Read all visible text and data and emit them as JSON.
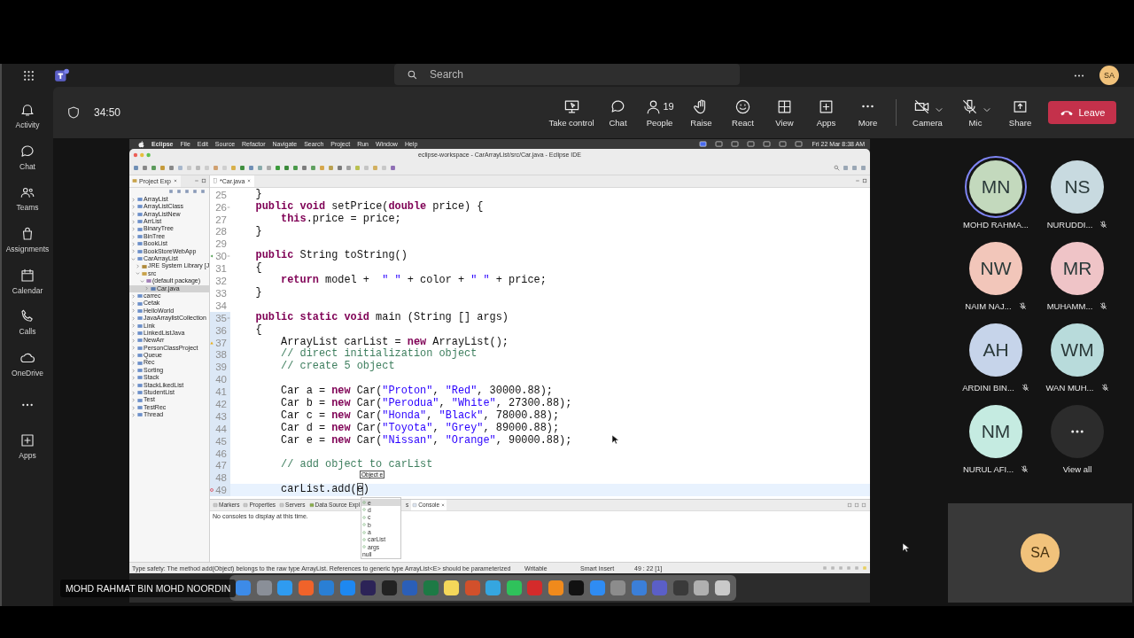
{
  "topbar": {
    "search": {
      "placeholder": "Search"
    },
    "user_initials": "SA"
  },
  "rail": [
    {
      "label": "Activity",
      "kind": "activity"
    },
    {
      "label": "Chat",
      "kind": "chat"
    },
    {
      "label": "Teams",
      "kind": "teams"
    },
    {
      "label": "Assignments",
      "kind": "assignments"
    },
    {
      "label": "Calendar",
      "kind": "calendar"
    },
    {
      "label": "Calls",
      "kind": "calls"
    },
    {
      "label": "OneDrive",
      "kind": "onedrive"
    },
    {
      "kind": "more"
    },
    {
      "label": "Apps",
      "kind": "apps"
    }
  ],
  "meeting": {
    "timer": "34:50",
    "controls": [
      {
        "label": "Take control",
        "kind": "take-control"
      },
      {
        "label": "Chat",
        "kind": "chat"
      },
      {
        "label": "People",
        "kind": "people",
        "count": "19"
      },
      {
        "label": "Raise",
        "kind": "raise"
      },
      {
        "label": "React",
        "kind": "react"
      },
      {
        "label": "View",
        "kind": "view"
      },
      {
        "label": "Apps",
        "kind": "apps"
      },
      {
        "label": "More",
        "kind": "more"
      }
    ],
    "devices": [
      {
        "label": "Camera",
        "kind": "camera",
        "off": true
      },
      {
        "label": "Mic",
        "kind": "mic",
        "off": true
      }
    ],
    "share": {
      "label": "Share"
    },
    "leave": {
      "label": "Leave"
    }
  },
  "participants": [
    {
      "initials": "MN",
      "name": "MOHD RAHMA...",
      "muted": false,
      "speaking": true,
      "color": "#c3d9bd"
    },
    {
      "initials": "NS",
      "name": "NURUDDI...",
      "muted": true,
      "speaking": false,
      "color": "#c8dae0"
    },
    {
      "initials": "NW",
      "name": "NAIM NAJ...",
      "muted": true,
      "speaking": false,
      "color": "#f2c6ba"
    },
    {
      "initials": "MR",
      "name": "MUHAMM...",
      "muted": true,
      "speaking": false,
      "color": "#efc4c7"
    },
    {
      "initials": "AH",
      "name": "ARDINI BIN...",
      "muted": true,
      "speaking": false,
      "color": "#c6d4ea"
    },
    {
      "initials": "WM",
      "name": "WAN MUH...",
      "muted": true,
      "speaking": false,
      "color": "#b8dbdb"
    },
    {
      "initials": "NM",
      "name": "NURUL AFI...",
      "muted": true,
      "speaking": false,
      "color": "#c5ebe1"
    }
  ],
  "view_all": {
    "label": "View all"
  },
  "self_view": {
    "initials": "SA",
    "color": "#f1c27b"
  },
  "presenter_name": "MOHD RAHMAT BIN MOHD NOORDIN",
  "mac_menu": {
    "app": "Eclipse",
    "items": [
      "File",
      "Edit",
      "Source",
      "Refactor",
      "Navigate",
      "Search",
      "Project",
      "Run",
      "Window",
      "Help"
    ],
    "clock": "Fri 22 Mar  8:38 AM"
  },
  "eclipse": {
    "title": "eclipse-workspace - CarArrayList/src/Car.java - Eclipse IDE",
    "explorer": {
      "tab": "Project Exp",
      "tree": [
        {
          "label": "ArrayList",
          "kind": "project",
          "expanded": false,
          "selected": false
        },
        {
          "label": "ArrayListClass",
          "kind": "project",
          "expanded": false,
          "selected": false
        },
        {
          "label": "ArrayListNew",
          "kind": "project",
          "expanded": false,
          "selected": false
        },
        {
          "label": "ArrList",
          "kind": "project",
          "expanded": false,
          "selected": false
        },
        {
          "label": "BinaryTree",
          "kind": "project",
          "expanded": false,
          "selected": false
        },
        {
          "label": "BinTree",
          "kind": "project",
          "expanded": false,
          "selected": false
        },
        {
          "label": "BookList",
          "kind": "project",
          "expanded": false,
          "selected": false
        },
        {
          "label": "BookStoreWebApp",
          "kind": "project",
          "expanded": false,
          "selected": false
        },
        {
          "label": "CarArrayList",
          "kind": "project",
          "expanded": true,
          "selected": false,
          "children": [
            {
              "label": "JRE System Library [J",
              "kind": "library",
              "expanded": false,
              "selected": false
            },
            {
              "label": "src",
              "kind": "folder",
              "expanded": true,
              "selected": false,
              "children": [
                {
                  "label": "(default package)",
                  "kind": "package",
                  "expanded": true,
                  "selected": false,
                  "children": [
                    {
                      "label": "Car.java",
                      "kind": "file",
                      "expanded": false,
                      "selected": true
                    }
                  ]
                }
              ]
            }
          ]
        },
        {
          "label": "carrec",
          "kind": "project",
          "expanded": false,
          "selected": false
        },
        {
          "label": "Cetak",
          "kind": "project",
          "expanded": false,
          "selected": false
        },
        {
          "label": "HelloWorld",
          "kind": "project",
          "expanded": false,
          "selected": false
        },
        {
          "label": "JavaArraylistCollection",
          "kind": "project",
          "expanded": false,
          "selected": false
        },
        {
          "label": "Link",
          "kind": "project",
          "expanded": false,
          "selected": false
        },
        {
          "label": "LinkedListJava",
          "kind": "project",
          "expanded": false,
          "selected": false
        },
        {
          "label": "NewArr",
          "kind": "project",
          "expanded": false,
          "selected": false
        },
        {
          "label": "PersonClassProject",
          "kind": "project",
          "expanded": false,
          "selected": false
        },
        {
          "label": "Queue",
          "kind": "project",
          "expanded": false,
          "selected": false
        },
        {
          "label": "Rec",
          "kind": "project",
          "expanded": false,
          "selected": false
        },
        {
          "label": "Sorting",
          "kind": "project",
          "expanded": false,
          "selected": false
        },
        {
          "label": "Stack",
          "kind": "project",
          "expanded": false,
          "selected": false
        },
        {
          "label": "StackLikedList",
          "kind": "project",
          "expanded": false,
          "selected": false
        },
        {
          "label": "StudentList",
          "kind": "project",
          "expanded": false,
          "selected": false
        },
        {
          "label": "Test",
          "kind": "project",
          "expanded": false,
          "selected": false
        },
        {
          "label": "TestRec",
          "kind": "project",
          "expanded": false,
          "selected": false
        },
        {
          "label": "Thread",
          "kind": "project",
          "expanded": false,
          "selected": false
        }
      ]
    },
    "editor": {
      "tab": "*Car.java",
      "lines": [
        {
          "num": "25",
          "kind": "plain",
          "in_scope": false,
          "current": false,
          "parts": [
            {
              "kind": "plain",
              "text": "    }"
            }
          ]
        },
        {
          "num": "26",
          "kind": "fold",
          "in_scope": false,
          "current": false,
          "parts": [
            {
              "kind": "keyword",
              "text": "    public void"
            },
            {
              "kind": "plain",
              "text": " setPrice("
            },
            {
              "kind": "keyword",
              "text": "double"
            },
            {
              "kind": "plain",
              "text": " price) {"
            }
          ]
        },
        {
          "num": "27",
          "kind": "plain",
          "in_scope": false,
          "current": false,
          "parts": [
            {
              "kind": "keyword",
              "text": "        this"
            },
            {
              "kind": "plain",
              "text": ".price = price;"
            }
          ]
        },
        {
          "num": "28",
          "kind": "plain",
          "in_scope": false,
          "current": false,
          "parts": [
            {
              "kind": "plain",
              "text": "    }"
            }
          ]
        },
        {
          "num": "29",
          "kind": "plain",
          "in_scope": false,
          "current": false
        },
        {
          "num": "30",
          "kind": "override",
          "in_scope": false,
          "current": false,
          "parts": [
            {
              "kind": "keyword",
              "text": "    public"
            },
            {
              "kind": "plain",
              "text": " String toString()"
            }
          ]
        },
        {
          "num": "31",
          "kind": "plain",
          "in_scope": false,
          "current": false,
          "parts": [
            {
              "kind": "plain",
              "text": "    {"
            }
          ]
        },
        {
          "num": "32",
          "kind": "plain",
          "in_scope": false,
          "current": false,
          "parts": [
            {
              "kind": "keyword",
              "text": "        return"
            },
            {
              "kind": "plain",
              "text": " model +  "
            },
            {
              "kind": "string",
              "text": "\" \""
            },
            {
              "kind": "plain",
              "text": " + color + "
            },
            {
              "kind": "string",
              "text": "\" \""
            },
            {
              "kind": "plain",
              "text": " + price;"
            }
          ]
        },
        {
          "num": "33",
          "kind": "plain",
          "in_scope": false,
          "current": false,
          "parts": [
            {
              "kind": "plain",
              "text": "    }"
            }
          ]
        },
        {
          "num": "34",
          "kind": "plain",
          "in_scope": false,
          "current": false
        },
        {
          "num": "35",
          "kind": "fold",
          "in_scope": true,
          "current": false,
          "parts": [
            {
              "kind": "keyword",
              "text": "    public static void"
            },
            {
              "kind": "plain",
              "text": " main (String [] args)"
            }
          ]
        },
        {
          "num": "36",
          "kind": "plain",
          "in_scope": true,
          "current": false,
          "parts": [
            {
              "kind": "plain",
              "text": "    {"
            }
          ]
        },
        {
          "num": "37",
          "kind": "warning",
          "in_scope": true,
          "current": false,
          "parts": [
            {
              "kind": "plain",
              "text": "        ArrayList carList = "
            },
            {
              "kind": "keyword",
              "text": "new"
            },
            {
              "kind": "plain",
              "text": " ArrayList();"
            }
          ]
        },
        {
          "num": "38",
          "kind": "plain",
          "in_scope": true,
          "current": false,
          "parts": [
            {
              "kind": "comment",
              "text": "        // direct initialization object"
            }
          ]
        },
        {
          "num": "39",
          "kind": "plain",
          "in_scope": true,
          "current": false,
          "parts": [
            {
              "kind": "comment",
              "text": "        // create 5 object"
            }
          ]
        },
        {
          "num": "40",
          "kind": "plain",
          "in_scope": true,
          "current": false
        },
        {
          "num": "41",
          "kind": "plain",
          "in_scope": true,
          "current": false,
          "parts": [
            {
              "kind": "plain",
              "text": "        Car a = "
            },
            {
              "kind": "keyword",
              "text": "new"
            },
            {
              "kind": "plain",
              "text": " Car("
            },
            {
              "kind": "string",
              "text": "\"Proton\""
            },
            {
              "kind": "plain",
              "text": ", "
            },
            {
              "kind": "string",
              "text": "\"Red\""
            },
            {
              "kind": "plain",
              "text": ", 30000.88);"
            }
          ]
        },
        {
          "num": "42",
          "kind": "plain",
          "in_scope": true,
          "current": false,
          "parts": [
            {
              "kind": "plain",
              "text": "        Car b = "
            },
            {
              "kind": "keyword",
              "text": "new"
            },
            {
              "kind": "plain",
              "text": " Car("
            },
            {
              "kind": "string",
              "text": "\"Perodua\""
            },
            {
              "kind": "plain",
              "text": ", "
            },
            {
              "kind": "string",
              "text": "\"White\""
            },
            {
              "kind": "plain",
              "text": ", 27300.88);"
            }
          ]
        },
        {
          "num": "43",
          "kind": "plain",
          "in_scope": true,
          "current": false,
          "parts": [
            {
              "kind": "plain",
              "text": "        Car c = "
            },
            {
              "kind": "keyword",
              "text": "new"
            },
            {
              "kind": "plain",
              "text": " Car("
            },
            {
              "kind": "string",
              "text": "\"Honda\""
            },
            {
              "kind": "plain",
              "text": ", "
            },
            {
              "kind": "string",
              "text": "\"Black\""
            },
            {
              "kind": "plain",
              "text": ", 78000.88);"
            }
          ]
        },
        {
          "num": "44",
          "kind": "plain",
          "in_scope": true,
          "current": false,
          "parts": [
            {
              "kind": "plain",
              "text": "        Car d = "
            },
            {
              "kind": "keyword",
              "text": "new"
            },
            {
              "kind": "plain",
              "text": " Car("
            },
            {
              "kind": "string",
              "text": "\"Toyota\""
            },
            {
              "kind": "plain",
              "text": ", "
            },
            {
              "kind": "string",
              "text": "\"Grey\""
            },
            {
              "kind": "plain",
              "text": ", 89000.88);"
            }
          ]
        },
        {
          "num": "45",
          "kind": "plain",
          "in_scope": true,
          "current": false,
          "parts": [
            {
              "kind": "plain",
              "text": "        Car e = "
            },
            {
              "kind": "keyword",
              "text": "new"
            },
            {
              "kind": "plain",
              "text": " Car("
            },
            {
              "kind": "string",
              "text": "\"Nissan\""
            },
            {
              "kind": "plain",
              "text": ", "
            },
            {
              "kind": "string",
              "text": "\"Orange\""
            },
            {
              "kind": "plain",
              "text": ", 90000.88);"
            }
          ]
        },
        {
          "num": "46",
          "kind": "plain",
          "in_scope": true,
          "current": false
        },
        {
          "num": "47",
          "kind": "plain",
          "in_scope": true,
          "current": false,
          "parts": [
            {
              "kind": "comment",
              "text": "        // add object to carList"
            }
          ]
        },
        {
          "num": "48",
          "kind": "plain",
          "in_scope": true,
          "current": false
        },
        {
          "num": "49",
          "kind": "error",
          "in_scope": true,
          "current": true,
          "parts": [
            {
              "kind": "plain",
              "text": "        carList.add("
            },
            {
              "kind": "linked",
              "text": "e"
            },
            {
              "kind": "plain",
              "text": ")"
            }
          ]
        }
      ],
      "autocomplete": {
        "hint": "Object e",
        "items": [
          {
            "label": "e",
            "kind": "variable",
            "selected": true
          },
          {
            "label": "d",
            "kind": "variable",
            "selected": false
          },
          {
            "label": "c",
            "kind": "variable",
            "selected": false
          },
          {
            "label": "b",
            "kind": "variable",
            "selected": false
          },
          {
            "label": "a",
            "kind": "variable",
            "selected": false
          },
          {
            "label": "carList",
            "kind": "variable",
            "selected": false
          },
          {
            "label": "args",
            "kind": "variable",
            "selected": false
          },
          {
            "label": "null",
            "kind": "keyword",
            "selected": false
          }
        ]
      }
    },
    "bottom": {
      "tabs": [
        {
          "label": "Markers",
          "kind": "markers",
          "selected": false
        },
        {
          "label": "Properties",
          "kind": "properties",
          "selected": false
        },
        {
          "label": "Servers",
          "kind": "servers",
          "selected": false
        },
        {
          "label": "Data Source Expl",
          "kind": "datasource",
          "selected": false
        },
        {
          "label": "s",
          "kind": "hidden",
          "selected": false
        },
        {
          "label": "Console",
          "kind": "console",
          "selected": true
        }
      ],
      "message": "No consoles to display at this time."
    },
    "status": {
      "message": "Type safety: The method add(Object) belongs to the raw type ArrayList. References to generic type ArrayList<E> should be parameterized",
      "mode": "Writable",
      "insert": "Smart Insert",
      "position": "49 : 22 [1]"
    }
  },
  "dock": [
    {
      "color": "#3d8be8"
    },
    {
      "color": "#8a8f98"
    },
    {
      "color": "#2f9bf0"
    },
    {
      "color": "#f0632a"
    },
    {
      "color": "#2a7fd4"
    },
    {
      "color": "#1e88f0"
    },
    {
      "color": "#2c2357"
    },
    {
      "color": "#222222"
    },
    {
      "color": "#2b5fb8"
    },
    {
      "color": "#1d7a45"
    },
    {
      "color": "#f4d75a"
    },
    {
      "color": "#d2502b"
    },
    {
      "color": "#35a6e0"
    },
    {
      "color": "#2fc25b"
    },
    {
      "color": "#d42b2b"
    },
    {
      "color": "#f08a1c"
    },
    {
      "color": "#111111"
    },
    {
      "color": "#2f8cf3"
    },
    {
      "color": "#8c8c8c"
    },
    {
      "color": "#3b7fd9"
    },
    {
      "color": "#5b5fc7"
    },
    {
      "color": "#3a3a3a"
    },
    {
      "color": "#b0b0b0"
    },
    {
      "color": "#c9c9c9"
    }
  ]
}
